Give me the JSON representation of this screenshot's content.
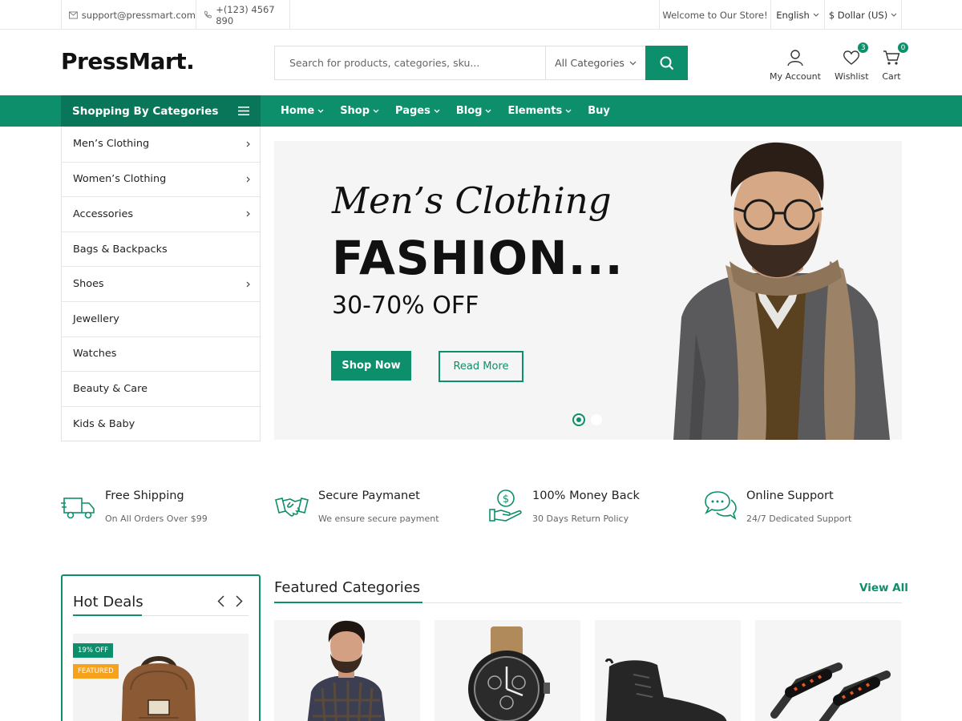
{
  "topbar": {
    "email": "support@pressmart.com",
    "phone": "+(123) 4567 890",
    "welcome": "Welcome to Our Store!",
    "language": "English",
    "currency": "$ Dollar (US)"
  },
  "header": {
    "logo": "PressMart.",
    "search_placeholder": "Search for products, categories, sku...",
    "search_category": "All Categories",
    "account_label": "My Account",
    "wishlist_label": "Wishlist",
    "wishlist_count": "3",
    "cart_label": "Cart",
    "cart_count": "0"
  },
  "nav": {
    "categories_label": "Shopping By Categories",
    "menu": [
      {
        "label": "Home"
      },
      {
        "label": "Shop"
      },
      {
        "label": "Pages"
      },
      {
        "label": "Blog"
      },
      {
        "label": "Elements"
      },
      {
        "label": "Buy"
      }
    ]
  },
  "sidebar": {
    "items": [
      {
        "label": "Men’s Clothing"
      },
      {
        "label": "Women’s Clothing"
      },
      {
        "label": "Accessories"
      },
      {
        "label": "Bags & Backpacks"
      },
      {
        "label": "Shoes"
      },
      {
        "label": "Jewellery"
      },
      {
        "label": "Watches"
      },
      {
        "label": "Beauty & Care"
      },
      {
        "label": "Kids & Baby"
      }
    ]
  },
  "hero": {
    "script_title": "Men’s Clothing",
    "title": "FASHION...",
    "subtitle": "30-70% OFF",
    "primary_button": "Shop Now",
    "secondary_button": "Read More"
  },
  "features": [
    {
      "title": "Free Shipping",
      "subtitle": "On All Orders Over $99",
      "icon": "truck-icon"
    },
    {
      "title": "Secure Paymanet",
      "subtitle": "We ensure secure payment",
      "icon": "handshake-icon"
    },
    {
      "title": "100% Money Back",
      "subtitle": "30 Days Return Policy",
      "icon": "money-hand-icon"
    },
    {
      "title": "Online Support",
      "subtitle": "24/7 Dedicated Support",
      "icon": "chat-icon"
    }
  ],
  "hot_deals": {
    "title": "Hot Deals",
    "discount_tag": "19% OFF",
    "featured_tag": "FEATURED"
  },
  "featured_categories": {
    "title": "Featured Categories",
    "view_all": "View All"
  },
  "colors": {
    "accent": "#0e8f6c",
    "accent_dark": "#0a7659",
    "featured_tag": "#f7a21b"
  }
}
